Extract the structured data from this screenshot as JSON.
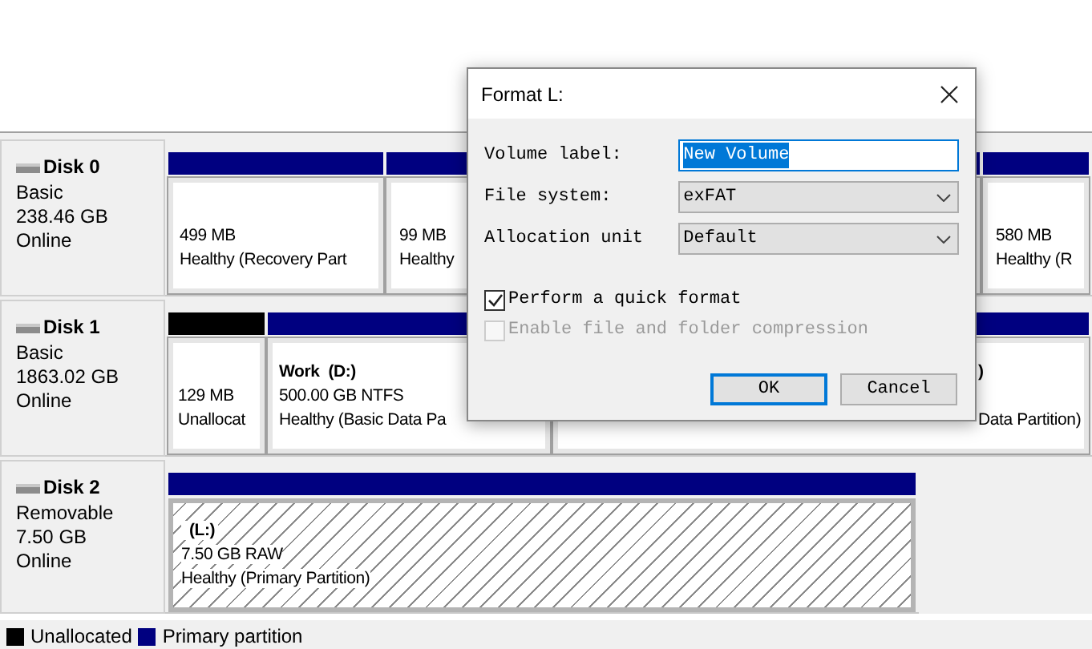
{
  "disks": [
    {
      "name": "Disk 0",
      "type": "Basic",
      "size": "238.46 GB",
      "status": "Online",
      "partitions": [
        {
          "kind": "primary",
          "selected": false,
          "size": "499 MB",
          "status": "Healthy (Recovery Part"
        },
        {
          "kind": "primary",
          "selected": false,
          "size": "99 MB",
          "status": "Healthy"
        },
        {
          "kind": "primary",
          "selected": false,
          "size": "580 MB",
          "status": "Healthy (R"
        }
      ]
    },
    {
      "name": "Disk 1",
      "type": "Basic",
      "size": "1863.02 GB",
      "status": "Online",
      "partitions": [
        {
          "kind": "unallocated",
          "selected": false,
          "size": "129 MB",
          "status": "Unallocat"
        },
        {
          "kind": "primary",
          "selected": false,
          "label": "Work  (D:)",
          "size": "500.00 GB NTFS",
          "status": "Healthy (Basic Data Pa"
        },
        {
          "kind": "primary",
          "selected": false,
          "label": ")",
          "status": "Data Partition)"
        }
      ]
    },
    {
      "name": "Disk 2",
      "type": "Removable",
      "size": "7.50 GB",
      "status": "Online",
      "partitions": [
        {
          "kind": "primary",
          "selected": true,
          "label": "(L:)",
          "size": "7.50 GB RAW",
          "status": "Healthy (Primary Partition)"
        }
      ]
    }
  ],
  "legend": [
    {
      "label": "Unallocated",
      "color": "#000000"
    },
    {
      "label": "Primary partition",
      "color": "#000080"
    }
  ],
  "dialog": {
    "title": "Format L:",
    "fields": [
      {
        "kind": "text",
        "label": "Volume label:",
        "value": "New Volume"
      },
      {
        "kind": "select",
        "label": "File system:",
        "value": "exFAT"
      },
      {
        "kind": "select",
        "label": "Allocation unit",
        "value": "Default"
      }
    ],
    "checkboxes": [
      {
        "label": "Perform a quick format",
        "checked": true,
        "disabled": false
      },
      {
        "label": "Enable file and folder compression",
        "checked": false,
        "disabled": true
      }
    ],
    "buttons": [
      {
        "label": "OK",
        "default": true
      },
      {
        "label": "Cancel",
        "default": false
      }
    ]
  }
}
